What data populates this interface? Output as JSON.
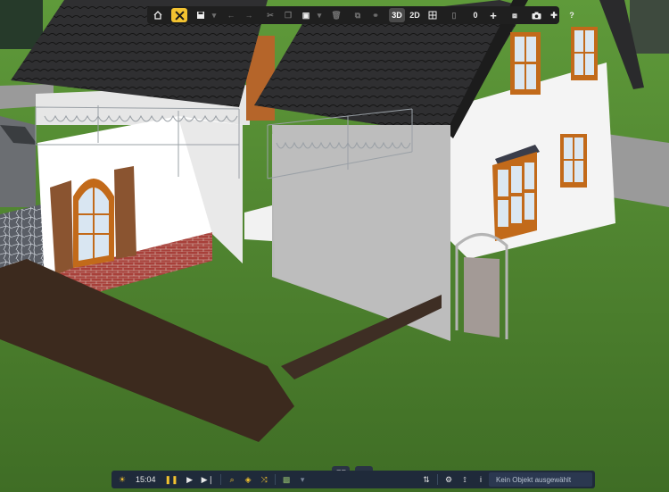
{
  "toolbar": {
    "buttons": [
      {
        "name": "home-icon"
      },
      {
        "name": "tools-icon",
        "active": true
      },
      {
        "name": "save-icon"
      },
      {
        "name": "undo-icon"
      },
      {
        "name": "redo-icon"
      },
      {
        "name": "cut-icon"
      },
      {
        "name": "copy-icon"
      },
      {
        "name": "paste-icon"
      },
      {
        "name": "delete-icon"
      },
      {
        "name": "group-icon"
      },
      {
        "name": "link-icon"
      },
      {
        "name": "grid-icon"
      },
      {
        "name": "lock-icon"
      },
      {
        "name": "add-icon"
      },
      {
        "name": "layers-icon"
      },
      {
        "name": "camera-icon"
      },
      {
        "name": "puzzle-icon"
      }
    ],
    "view_3d_label": "3D",
    "view_2d_label": "2D",
    "level_value": "0",
    "help_label": "?"
  },
  "bottom_bar": {
    "time": "15:04",
    "status_text": "Kein Objekt ausgewählt",
    "icons": [
      "sun-icon",
      "pause-icon",
      "play-icon",
      "skip-end-icon",
      "search-icon",
      "layers-icon",
      "shuffle-icon",
      "cube-icon",
      "settings-sliders-icon",
      "gear-icon",
      "path-icon",
      "info-icon"
    ]
  },
  "view_toggles": [
    {
      "name": "floorplan-view-icon"
    },
    {
      "name": "terrain-view-icon"
    }
  ],
  "colors": {
    "grass": "#4e7d2e",
    "roof": "#2b2b2b",
    "wall": "#f4f4f4",
    "window_frame": "#c26a1a",
    "toolbar_bg": "#1f1f1f",
    "accent_yellow": "#f2c230",
    "bottom_bar_bg": "#1f2a3a"
  }
}
